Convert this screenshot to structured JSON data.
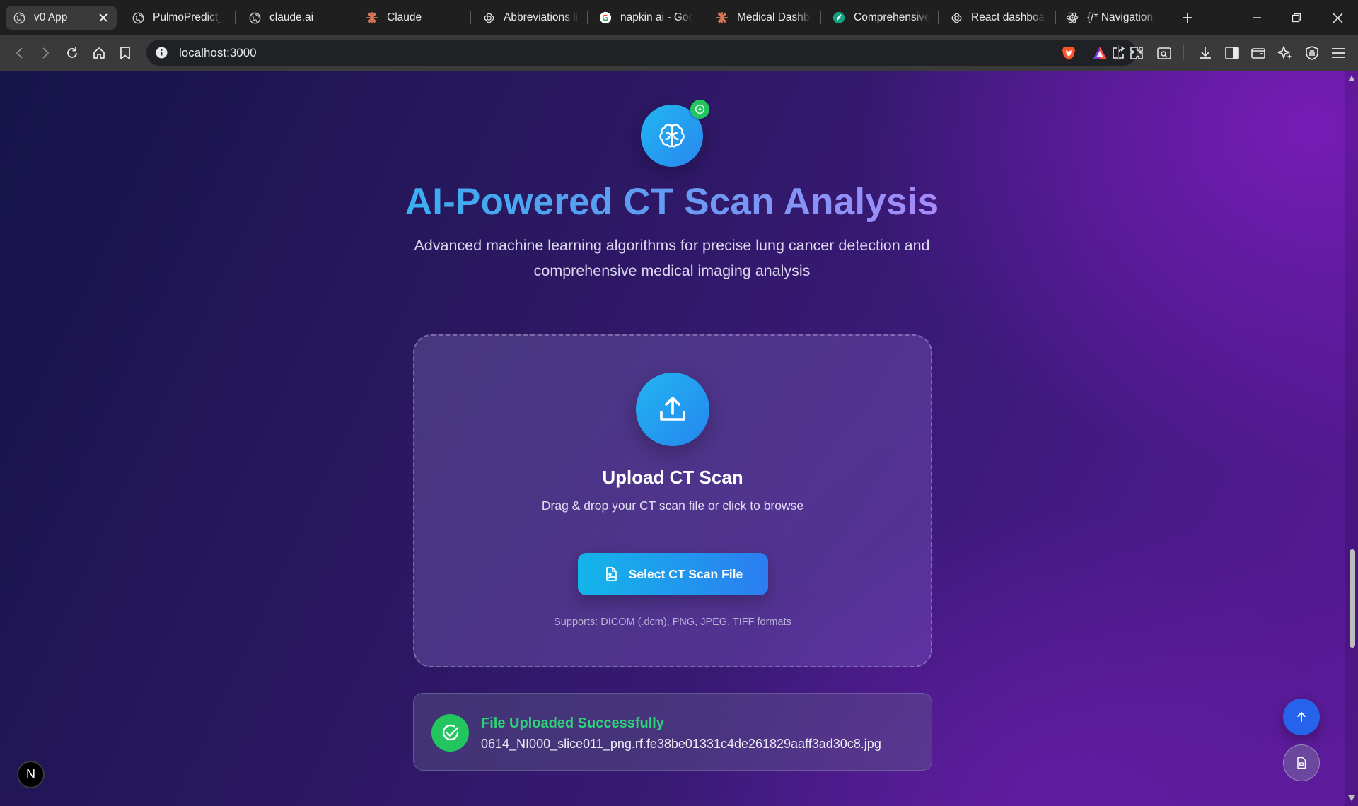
{
  "browser": {
    "tabs": [
      {
        "title": "v0 App",
        "icon": "globe-icon",
        "active": true
      },
      {
        "title": "PulmoPredict_R",
        "icon": "globe-icon"
      },
      {
        "title": "claude.ai",
        "icon": "globe-icon"
      },
      {
        "title": "Claude",
        "icon": "claude-icon"
      },
      {
        "title": "Abbreviations li",
        "icon": "openai-icon"
      },
      {
        "title": "napkin ai - Goo",
        "icon": "google-icon"
      },
      {
        "title": "Medical Dashbo",
        "icon": "claude-icon"
      },
      {
        "title": "Comprehensive",
        "icon": "feather-icon"
      },
      {
        "title": "React dashboar",
        "icon": "openai-icon"
      },
      {
        "title": "{/* Navigation I",
        "icon": "react-icon"
      }
    ],
    "url": "localhost:3000"
  },
  "hero": {
    "title": "AI-Powered CT Scan Analysis",
    "subtitle_line1": "Advanced machine learning algorithms for precise lung cancer detection and",
    "subtitle_line2": "comprehensive medical imaging analysis"
  },
  "upload": {
    "title": "Upload CT Scan",
    "subtitle": "Drag & drop your CT scan file or click to browse",
    "button_label": "Select CT Scan File",
    "supports": "Supports: DICOM (.dcm), PNG, JPEG, TIFF formats"
  },
  "status": {
    "title": "File Uploaded Successfully",
    "filename": "0614_NI000_slice011_png.rf.fe38be01331c4de261829aaff3ad30c8.jpg"
  },
  "dev_badge": "N",
  "colors": {
    "accent_blue": "#2563eb",
    "success_green": "#22c55e",
    "gradient_start": "#13b6ea",
    "gradient_end": "#2c7df0"
  }
}
